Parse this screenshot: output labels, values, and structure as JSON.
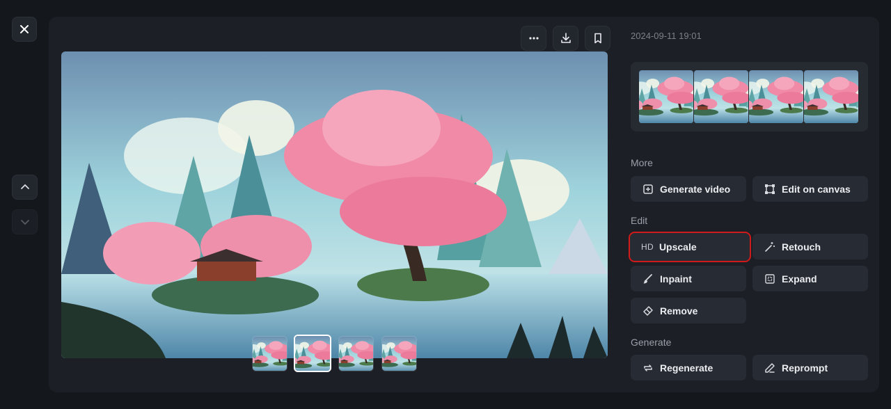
{
  "window": {
    "close_icon": "close-icon",
    "nav_up_icon": "chevron-up-icon",
    "nav_down_icon": "chevron-down-icon"
  },
  "toolbar": {
    "more_icon": "more-icon",
    "download_icon": "download-icon",
    "bookmark_icon": "bookmark-icon"
  },
  "image": {
    "thumbnails": [
      {
        "selected": false
      },
      {
        "selected": true
      },
      {
        "selected": false
      },
      {
        "selected": false
      }
    ]
  },
  "details": {
    "timestamp": "2024-09-11 19:01",
    "variants_count": 4
  },
  "sections": {
    "more": {
      "label": "More",
      "actions": [
        {
          "label": "Generate video",
          "icon": "video-plus-icon"
        },
        {
          "label": "Edit on canvas",
          "icon": "canvas-frame-icon"
        }
      ]
    },
    "edit": {
      "label": "Edit",
      "actions": [
        {
          "label": "Upscale",
          "icon": "hd-icon",
          "icon_text": "HD",
          "highlighted": true
        },
        {
          "label": "Retouch",
          "icon": "magic-wand-icon"
        },
        {
          "label": "Inpaint",
          "icon": "inpaint-brush-icon"
        },
        {
          "label": "Expand",
          "icon": "expand-icon"
        },
        {
          "label": "Remove",
          "icon": "eraser-icon"
        }
      ]
    },
    "generate": {
      "label": "Generate",
      "actions": [
        {
          "label": "Regenerate",
          "icon": "refresh-icon"
        },
        {
          "label": "Reprompt",
          "icon": "pencil-icon"
        }
      ]
    }
  },
  "colors": {
    "highlight": "#d11a1a",
    "panel": "#1c1f25",
    "button": "#272b33"
  }
}
